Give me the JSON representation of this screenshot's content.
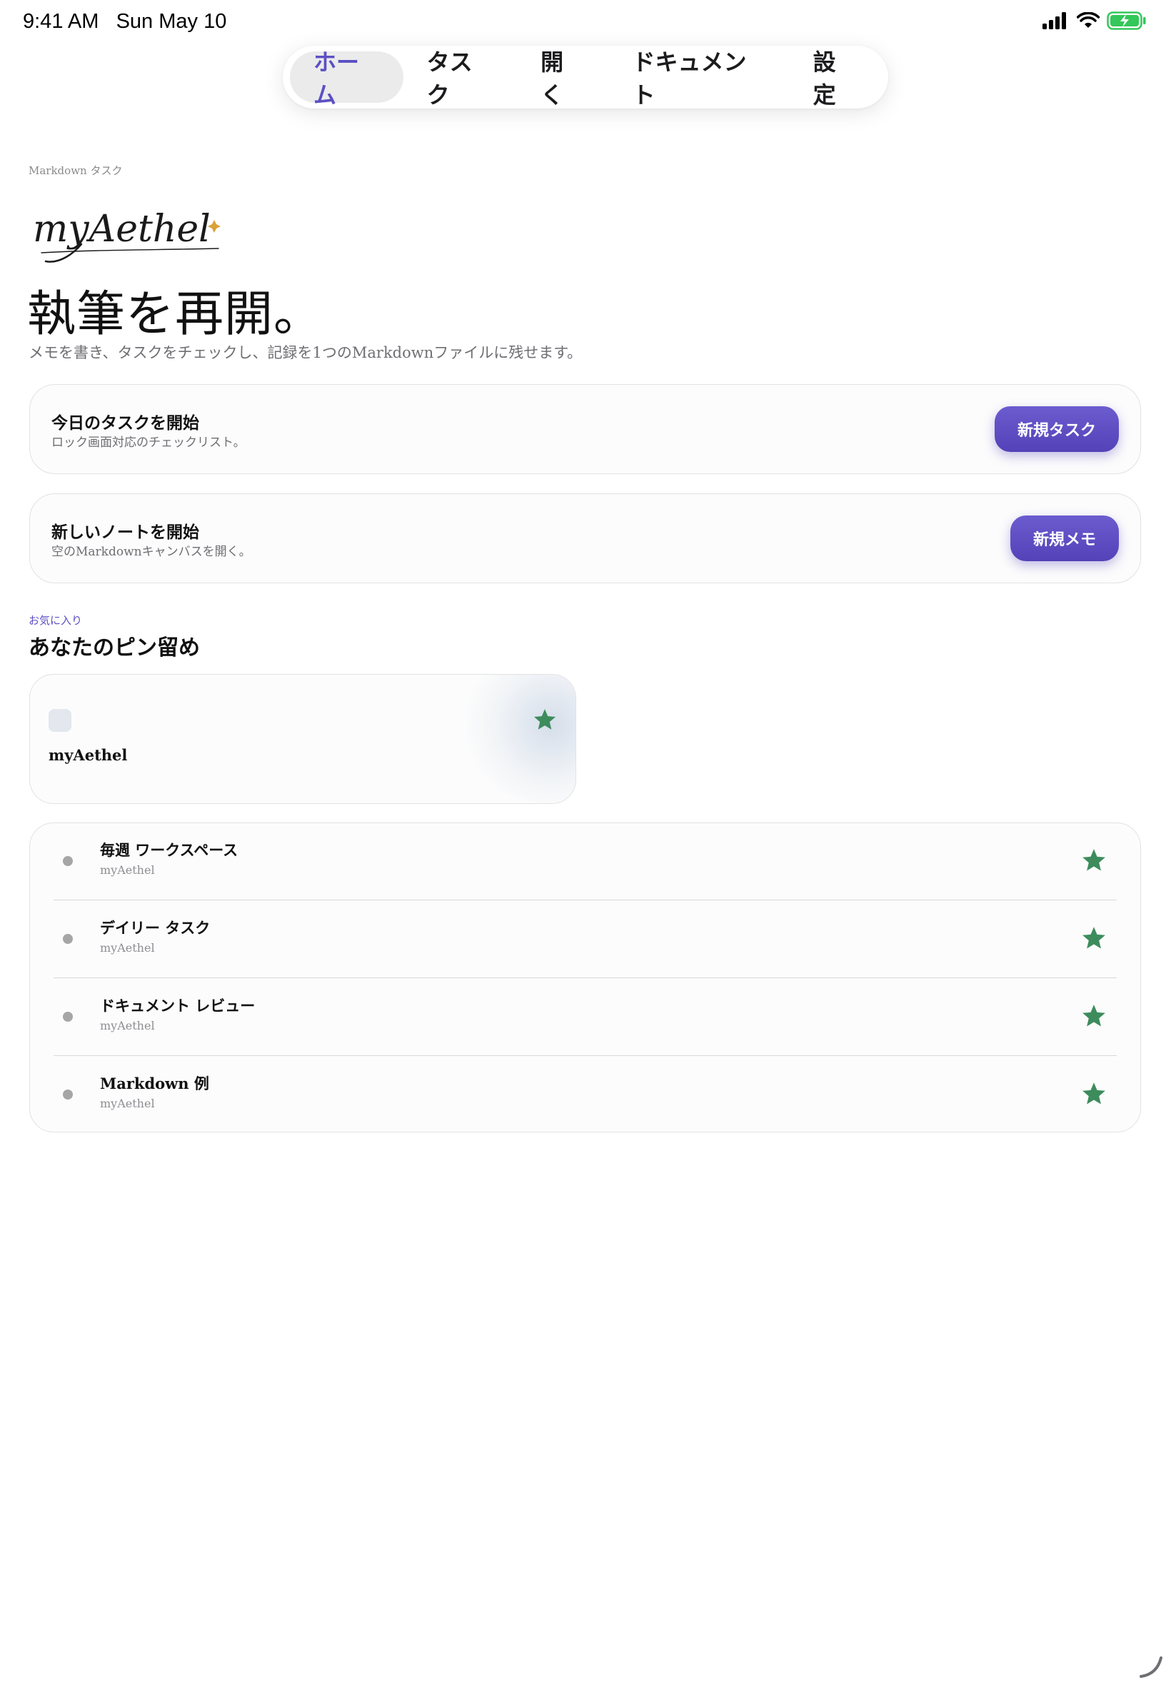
{
  "status_bar": {
    "time": "9:41 AM",
    "date": "Sun May 10"
  },
  "nav": {
    "tabs": [
      {
        "label": "ホーム",
        "active": true
      },
      {
        "label": "タスク",
        "active": false
      },
      {
        "label": "開く",
        "active": false
      },
      {
        "label": "ドキュメント",
        "active": false
      },
      {
        "label": "設定",
        "active": false
      }
    ]
  },
  "hero": {
    "eyebrow": "Markdown タスク",
    "logo_text": "myAethel",
    "title": "執筆を再開。",
    "subtitle": "メモを書き、タスクをチェックし、記録を1つのMarkdownファイルに残せます。"
  },
  "actions": [
    {
      "title": "今日のタスクを開始",
      "description": "ロック画面対応のチェックリスト。",
      "button": "新規タスク"
    },
    {
      "title": "新しいノートを開始",
      "description": "空のMarkdownキャンバスを開く。",
      "button": "新規メモ"
    }
  ],
  "pinned_section": {
    "eyebrow": "お気に入り",
    "title": "あなたのピン留め"
  },
  "pinned_card": {
    "title": "myAethel"
  },
  "pinned_list": [
    {
      "title": "毎週 ワークスペース",
      "subtitle": "myAethel"
    },
    {
      "title": "デイリー タスク",
      "subtitle": "myAethel"
    },
    {
      "title": "ドキュメント レビュー",
      "subtitle": "myAethel"
    },
    {
      "title": "Markdown 例",
      "subtitle": "myAethel"
    }
  ],
  "colors": {
    "accent": "#5b4fc4",
    "star": "#3d8c5c",
    "battery": "#34c759",
    "sparkle": "#d9a23a"
  },
  "icons": {
    "star": "star-icon",
    "wifi": "wifi-icon",
    "signal": "cellular-signal-icon",
    "battery": "battery-charging-icon"
  }
}
